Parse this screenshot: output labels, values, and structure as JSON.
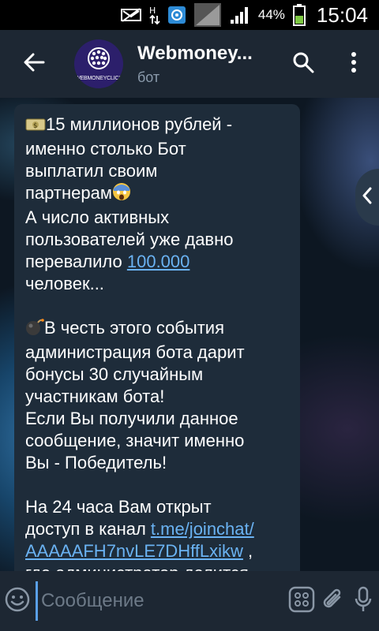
{
  "status_bar": {
    "battery_percent": "44%",
    "time": "15:04",
    "icons": [
      "notification-icon",
      "data-arrows-icon",
      "vpn-icon",
      "no-signal-icon",
      "signal-icon",
      "battery-icon"
    ]
  },
  "header": {
    "title": "Webmoney...",
    "subtitle": "бот",
    "avatar_text": "WEBMONEYCLICK",
    "icons": [
      "back-arrow-icon",
      "search-icon",
      "more-vertical-icon"
    ]
  },
  "message": {
    "line1": "15 миллионов рублей -",
    "line2": "именно столько Бот",
    "line3": "выплатил своим",
    "line4": "партнерам",
    "line5": "А число активных",
    "line6": "пользователей уже давно",
    "line7_prefix": "перевалило ",
    "line7_link": "100.000",
    "line8": "человек...",
    "line9": "В честь этого события",
    "line10": "администрация бота дарит",
    "line11": "бонусы 30 случайным",
    "line12": "участникам бота!",
    "line13": "Если Вы получили данное",
    "line14": "сообщение, значит именно",
    "line15": "Вы - Победитель!",
    "line16": "На 24 часа Вам открыт",
    "line17_prefix": "доступ в канал ",
    "line17_link": "t.me/joinchat/",
    "line18_link": "AAAAAFH7nvLE7DHffLxikw",
    "line18_suffix": " ,",
    "line19": "где администратор делится"
  },
  "input": {
    "placeholder": "Сообщение"
  },
  "colors": {
    "header_bg": "#1d2733",
    "bubble_bg": "#1e2c3a",
    "link": "#6ab2f2",
    "accent": "#5aa0e8"
  }
}
